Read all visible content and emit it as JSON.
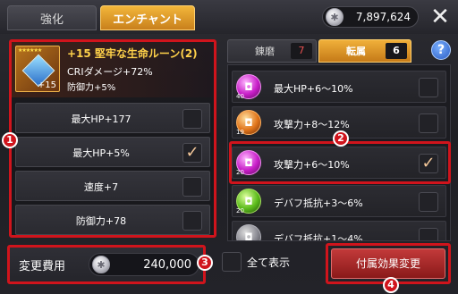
{
  "header": {
    "tabs": [
      {
        "label": "強化",
        "active": false
      },
      {
        "label": "エンチャント",
        "active": true
      }
    ],
    "currency_value": "7,897,624",
    "currency_icon": "silver-coin-icon",
    "close_icon": "close-icon"
  },
  "rune": {
    "stars": "★★★★★★",
    "level_badge": "+15",
    "title": "+15 堅牢な生命ルーン(2)",
    "main_stat": "CRIダメージ+72%",
    "sub_stat": "防御力+5%"
  },
  "options": [
    {
      "label": "最大HP+177",
      "checked": false,
      "check_mark": ""
    },
    {
      "label": "最大HP+5%",
      "checked": true,
      "check_mark": "✓"
    },
    {
      "label": "速度+7",
      "checked": false,
      "check_mark": ""
    },
    {
      "label": "防御力+78",
      "checked": false,
      "check_mark": ""
    }
  ],
  "right_tabs": [
    {
      "label": "錬磨",
      "count": "7",
      "active": false
    },
    {
      "label": "転属",
      "count": "6",
      "active": true
    }
  ],
  "help_label": "?",
  "runes": [
    {
      "level": "40",
      "name": "最大HP+6～10%",
      "color": "purple",
      "checked": false,
      "check_mark": ""
    },
    {
      "level": "19",
      "name": "攻撃力+8～12%",
      "color": "orange",
      "checked": false,
      "check_mark": ""
    },
    {
      "level": "20",
      "name": "攻撃力+6～10%",
      "color": "purple",
      "checked": true,
      "check_mark": "✓"
    },
    {
      "level": "20",
      "name": "デバフ抵抗+3～6%",
      "color": "green",
      "checked": false,
      "check_mark": ""
    },
    {
      "level": "",
      "name": "デバフ抵抗+1～4%",
      "color": "gray",
      "checked": false,
      "check_mark": ""
    }
  ],
  "footer": {
    "cost_label": "変更費用",
    "cost_value": "240,000",
    "show_all_label": "全て表示",
    "change_button_label": "付属効果変更"
  },
  "markers": [
    "1",
    "2",
    "3",
    "4"
  ],
  "colors": {
    "highlight": "#d0141c",
    "active_tab": "#e09a28",
    "rune_title": "#ffd24a",
    "inactive_count": "#e85050"
  }
}
